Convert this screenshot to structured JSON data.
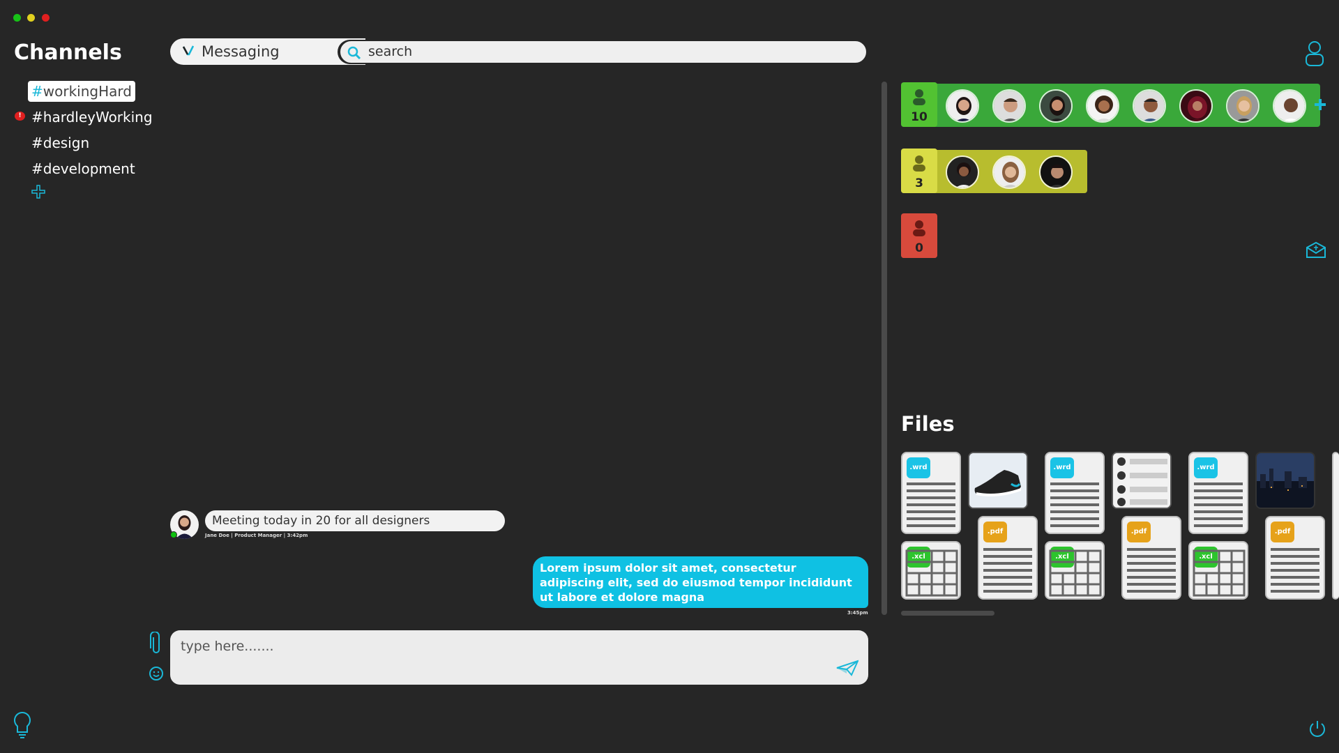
{
  "window_controls": {
    "close_color": "#e01f1f",
    "minimize_color": "#e0d01f",
    "maximize_color": "#17c217"
  },
  "channels": {
    "title": "Channels",
    "items": [
      {
        "hash": "#",
        "name": "workingHard",
        "active": true
      },
      {
        "hash": "#",
        "name": "hardleyWorking",
        "unread_badge": "!"
      },
      {
        "hash": "#",
        "name": "design"
      },
      {
        "hash": "#",
        "name": "development"
      }
    ],
    "add_icon": "plus-icon"
  },
  "header": {
    "app_label": "Messaging",
    "search_placeholder": "search"
  },
  "messages": [
    {
      "direction": "incoming",
      "text": "Meeting today in 20 for all designers",
      "meta": "Jane Doe | Product Manager | 3:42pm"
    },
    {
      "direction": "outgoing",
      "text": "Lorem ipsum dolor sit amet, consectetur adipiscing elit, sed do eiusmod tempor incididunt ut labore et dolore magna",
      "time": "3:45pm"
    }
  ],
  "composer": {
    "placeholder": "type here......."
  },
  "groups": [
    {
      "status": "online",
      "count": "10",
      "color": "#3aa83a",
      "badge_color": "#52c232",
      "avatars": 8
    },
    {
      "status": "away",
      "count": "3",
      "color": "#b8bd2e",
      "badge_color": "#d9dc46",
      "avatars": 3
    },
    {
      "status": "offline",
      "count": "0",
      "color": "#d84a3c",
      "badge_color": "#d84a3c",
      "avatars": 0
    }
  ],
  "files": {
    "title": "Files",
    "tags": {
      "word": ".wrd",
      "pdf": ".pdf",
      "excel": ".xcl"
    }
  },
  "accent_color": "#1ab8d8"
}
